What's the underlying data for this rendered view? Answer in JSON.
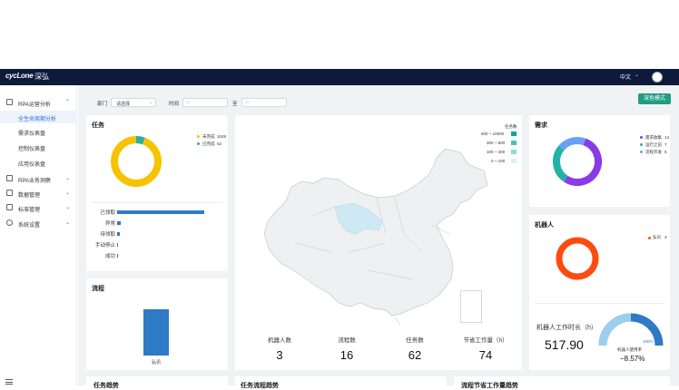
{
  "header": {
    "logo": "cycLone",
    "brand": "深弘",
    "language": "中文",
    "colors": {
      "bar": "#0d1a3a"
    }
  },
  "sidebar": {
    "items": [
      {
        "label": "RPA运营分析",
        "expanded": true
      },
      {
        "label": "RPA业务洞察"
      },
      {
        "label": "数据管理"
      },
      {
        "label": "标准管理"
      },
      {
        "label": "系统设置"
      }
    ],
    "subitems": [
      "全生命周期分析",
      "需求仪表盘",
      "控制仪表盘",
      "应用仪表盘"
    ],
    "active": "全生命周期分析"
  },
  "filters": {
    "dept_label": "部门",
    "dept_value": "请选择",
    "time_label": "时间",
    "to_label": "至",
    "mode_button": "深色模式"
  },
  "task": {
    "title": "任务",
    "legend": [
      {
        "label": "未完成",
        "value": "1049",
        "color": "#f5c300"
      },
      {
        "label": "已完成",
        "value": "62",
        "color": "#26b1a8"
      }
    ],
    "bars": [
      {
        "label": "已领取",
        "value": 100
      },
      {
        "label": "异常",
        "value": 4
      },
      {
        "label": "待领取",
        "value": 3
      },
      {
        "label": "手动停止",
        "value": 1
      },
      {
        "label": "成功",
        "value": 0.5
      }
    ]
  },
  "flow": {
    "title": "流程",
    "bar_label": "弘讯",
    "value": 1
  },
  "map": {
    "legend_title": "任务数",
    "legend": [
      {
        "label": "600 ~ 10000",
        "color": "#10a39b"
      },
      {
        "label": "300 ~ 600",
        "color": "#43c3bb"
      },
      {
        "label": "100 ~ 300",
        "color": "#8ddcd4"
      },
      {
        "label": "0 ~ 100",
        "color": "#d5f3f0"
      }
    ],
    "stats": [
      {
        "label": "机器人数",
        "value": "3"
      },
      {
        "label": "流程数",
        "value": "16"
      },
      {
        "label": "任务数",
        "value": "62"
      },
      {
        "label": "节省工作量（h）",
        "value": "74"
      }
    ]
  },
  "demand": {
    "title": "需求",
    "legend": [
      {
        "label": "需求收集",
        "value": "14",
        "color": "#8a3be6"
      },
      {
        "label": "运行之前",
        "value": "7",
        "color": "#23b3a6"
      },
      {
        "label": "流程开发",
        "value": "5",
        "color": "#6a9ff5"
      }
    ]
  },
  "robot": {
    "title": "机器人",
    "legend": [
      {
        "label": "弘讯",
        "value": "3",
        "color": "#ff4a10"
      }
    ],
    "work_label": "机器人工作时长（h）",
    "work_value": "517.90",
    "gauge_pct": "100%",
    "usage_label": "机器人使用率",
    "usage_value": "−8.57%"
  },
  "bottom_titles": [
    "任务趋势",
    "任务流程趋势",
    "流程节省工作量趋势"
  ]
}
